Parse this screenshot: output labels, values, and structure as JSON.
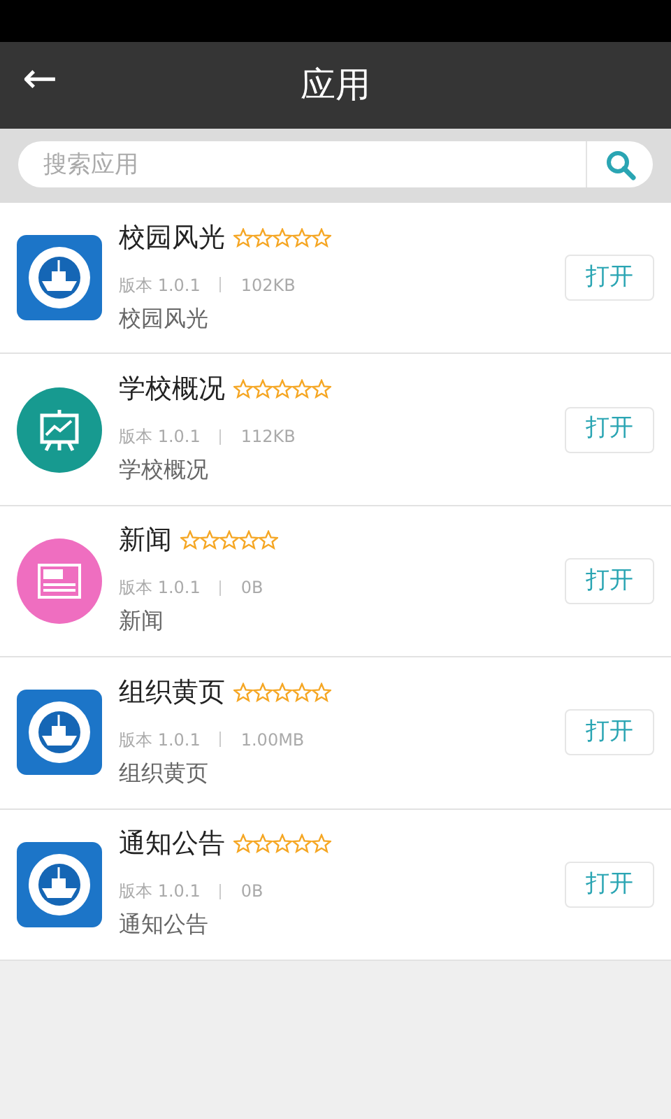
{
  "header": {
    "back_icon": "←",
    "title": "应用"
  },
  "search": {
    "placeholder": "搜索应用"
  },
  "apps": [
    {
      "name": "校园风光",
      "stars": 0,
      "version": "版本 1.0.1",
      "size": "102KB",
      "description": "校园风光",
      "kind": "emblem",
      "button": "打开"
    },
    {
      "name": "学校概况",
      "stars": 0,
      "version": "版本 1.0.1",
      "size": "112KB",
      "description": "学校概况",
      "kind": "chart",
      "button": "打开"
    },
    {
      "name": "新闻",
      "stars": 0,
      "version": "版本 1.0.1",
      "size": "0B",
      "description": "新闻",
      "kind": "news",
      "button": "打开"
    },
    {
      "name": "组织黄页",
      "stars": 0,
      "version": "版本 1.0.1",
      "size": "1.00MB",
      "description": "组织黄页",
      "kind": "emblem",
      "button": "打开"
    },
    {
      "name": "通知公告",
      "stars": 0,
      "version": "版本 1.0.1",
      "size": "0B",
      "description": "通知公告",
      "kind": "emblem",
      "button": "打开"
    }
  ]
}
